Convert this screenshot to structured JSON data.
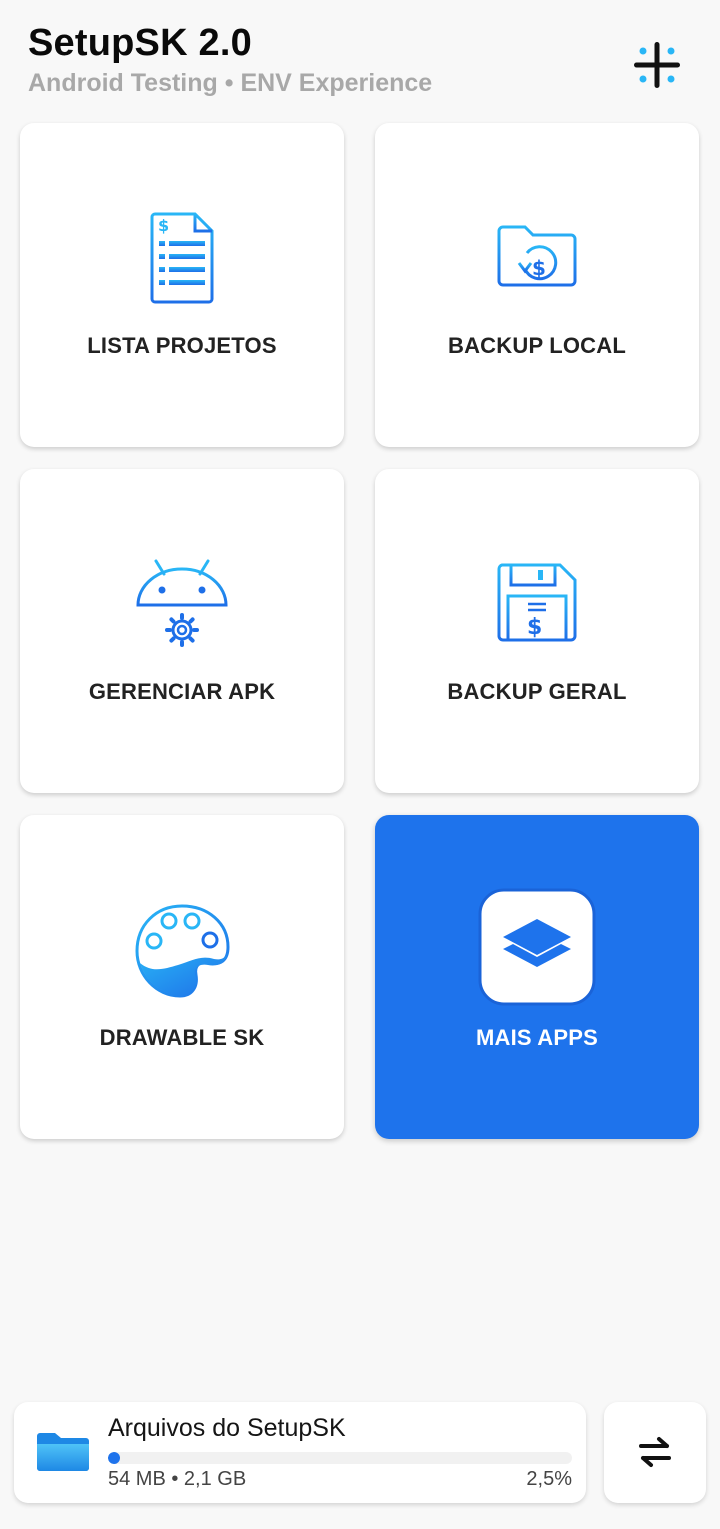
{
  "app": {
    "title": "SetupSK 2.0",
    "subtitle": "Android Testing • ENV Experience"
  },
  "header": {
    "menu_icon": "plus-dots-icon"
  },
  "menu": [
    {
      "label": "LISTA PROJETOS",
      "icon": "document-list-icon"
    },
    {
      "label": "BACKUP LOCAL",
      "icon": "folder-restore-icon"
    },
    {
      "label": "GERENCIAR APK",
      "icon": "android-gear-icon"
    },
    {
      "label": "BACKUP GERAL",
      "icon": "floppy-disk-icon"
    },
    {
      "label": "DRAWABLE SK",
      "icon": "palette-icon"
    },
    {
      "label": "MAIS APPS",
      "icon": "layers-icon"
    }
  ],
  "files": {
    "title": "Arquivos do SetupSK",
    "size": "54 MB • 2,1 GB",
    "percent_label": "2,5%",
    "progress_fraction": 0.025,
    "icon": "folder-icon"
  },
  "swap_button": {
    "icon": "swap-arrows-icon"
  },
  "colors": {
    "accent": "#1e73ec",
    "icon_gradient_start": "#29b6f6",
    "icon_gradient_end": "#1e6fe8"
  }
}
